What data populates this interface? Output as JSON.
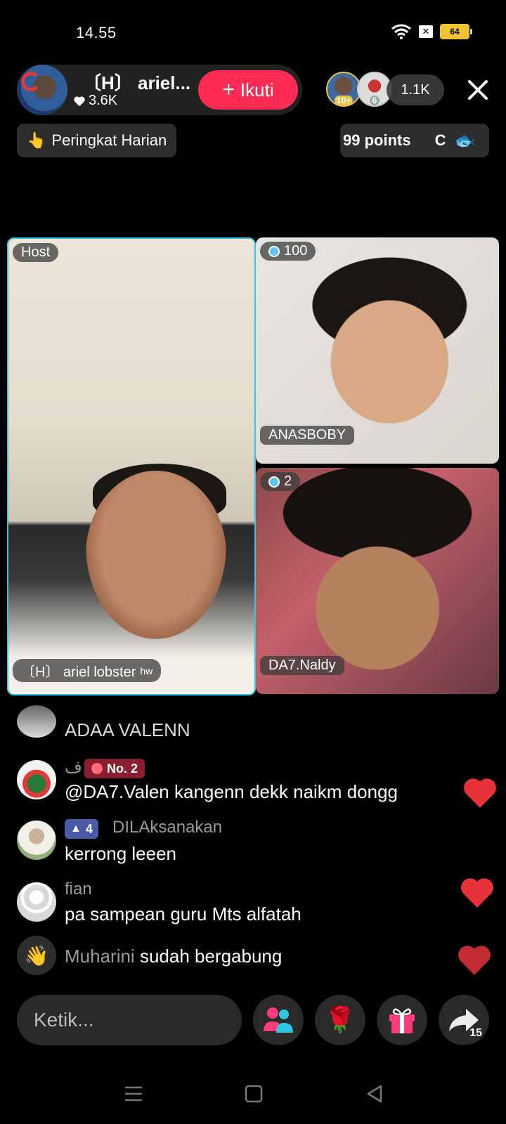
{
  "status": {
    "time": "14.55",
    "battery": "64"
  },
  "host": {
    "name": "〔H〕 ariel...",
    "likes": "3.6K",
    "follow_label": "Ikuti"
  },
  "viewers": {
    "badge1": "10+",
    "badge2": "6",
    "count": "1.1K"
  },
  "rank": {
    "label": "Peringkat Harian"
  },
  "points": {
    "label": "99 points",
    "extra": "C"
  },
  "tiles": {
    "host_tag": "Host",
    "host_name": "〔H〕 ariel lobster",
    "host_suffix": "hw",
    "guest1_score": "100",
    "guest1_name": "ANASBOBY",
    "guest2_score": "2",
    "guest2_name": "DA7.Naldy"
  },
  "chat": [
    {
      "name": "",
      "message": "ADAA VALENN"
    },
    {
      "name": "ف",
      "badge": "No. 2",
      "message": "@DA7.Valen kangenn dekk naikm dongg"
    },
    {
      "name": "DILAksanakan",
      "badge": "4",
      "message": "kerrong leeen"
    },
    {
      "name": "fian",
      "message": "pa sampean guru Mts alfatah"
    },
    {
      "name": "Muharini",
      "message": "sudah bergabung"
    }
  ],
  "input": {
    "placeholder": "Ketik..."
  },
  "share": {
    "count": "15"
  },
  "colors": {
    "accent": "#fe2c55",
    "host_border": "#2ec8e6",
    "heart": "#e8323a"
  }
}
